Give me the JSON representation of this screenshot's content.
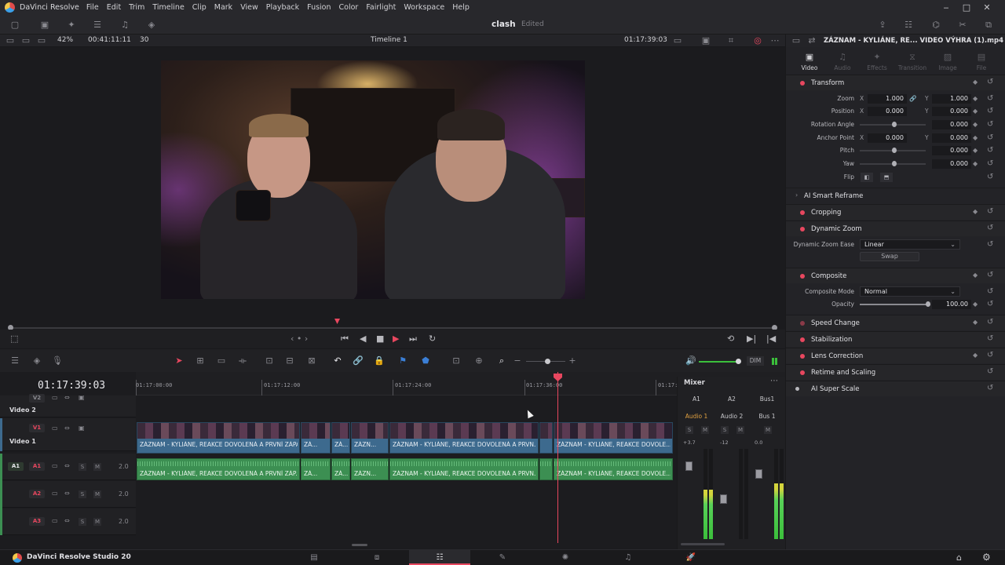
{
  "app": {
    "name": "DaVinci Resolve",
    "menus": [
      "File",
      "Edit",
      "Trim",
      "Timeline",
      "Clip",
      "Mark",
      "View",
      "Playback",
      "Fusion",
      "Color",
      "Fairlight",
      "Workspace",
      "Help"
    ],
    "window_controls": {
      "minimize": "‒",
      "maximize": "□",
      "close": "✕"
    }
  },
  "toolbar": {
    "project_name": "clash",
    "status": "Edited"
  },
  "viewer_bar": {
    "zoom": "42%",
    "duration_tc": "00:41:11:11",
    "fps": "30",
    "timeline_name": "Timeline 1",
    "current_tc": "01:17:39:03"
  },
  "inspector": {
    "clip_title": "ZÁZNAM - KYLIÁNE, RE... VIDEO VÝHRA (1).mp4",
    "tabs": [
      {
        "label": "Video",
        "icon": "video-icon",
        "active": true
      },
      {
        "label": "Audio",
        "icon": "audio-icon",
        "active": false
      },
      {
        "label": "Effects",
        "icon": "effects-icon",
        "active": false
      },
      {
        "label": "Transition",
        "icon": "transition-icon",
        "active": false
      },
      {
        "label": "Image",
        "icon": "image-icon",
        "active": false
      },
      {
        "label": "File",
        "icon": "file-icon",
        "active": false
      }
    ],
    "transform": {
      "title": "Transform",
      "zoom_label": "Zoom",
      "zoom_x": "1.000",
      "zoom_y": "1.000",
      "position_label": "Position",
      "position_x": "0.000",
      "position_y": "0.000",
      "rotation_label": "Rotation Angle",
      "rotation": "0.000",
      "anchor_label": "Anchor Point",
      "anchor_x": "0.000",
      "anchor_y": "0.000",
      "pitch_label": "Pitch",
      "pitch": "0.000",
      "yaw_label": "Yaw",
      "yaw": "0.000",
      "flip_label": "Flip",
      "x_axis": "X",
      "y_axis": "Y"
    },
    "ai_smart_reframe": "AI Smart Reframe",
    "cropping": "Cropping",
    "dynamic_zoom": {
      "title": "Dynamic Zoom",
      "ease_label": "Dynamic Zoom Ease",
      "ease_value": "Linear",
      "swap": "Swap"
    },
    "composite": {
      "title": "Composite",
      "mode_label": "Composite Mode",
      "mode_value": "Normal",
      "opacity_label": "Opacity",
      "opacity": "100.00"
    },
    "speed_change": "Speed Change",
    "stabilization": "Stabilization",
    "lens_correction": "Lens Correction",
    "retime_scaling": "Retime and Scaling",
    "ai_super_scale": "AI Super Scale"
  },
  "timeline": {
    "timecode": "01:17:39:03",
    "ruler_ticks": [
      "01:17:00:00",
      "01:17:12:00",
      "01:17:24:00",
      "01:17:36:00",
      "01:17:"
    ],
    "tracks": {
      "v2": {
        "badge": "V2",
        "name": "Video 2"
      },
      "v1": {
        "badge": "V1",
        "name": "Video 1"
      },
      "a1": {
        "badge": "A1",
        "patch": "A1",
        "level": "2.0"
      },
      "a2": {
        "badge": "A2",
        "level": "2.0"
      },
      "a3": {
        "badge": "A3",
        "level": "2.0"
      }
    },
    "solo": "S",
    "mute": "M",
    "video_clips": [
      "ZÁZNAM - KYLIÁNE, REAKCE DOVOLENÁ A PRVNÍ ZÁPASH ...",
      "ZÁ...",
      "ZÁ...",
      "ZÁZN...",
      "ZÁZNAM - KYLIÁNE, REAKCE DOVOLENÁ A PRVN...",
      "ZÁZNAM - KYLIÁNE, REAKCE DOVOLE..."
    ],
    "audio_clips": [
      "ZÁZNAM - KYLIÁNE, REAKCE DOVOLENÁ A PRVNÍ ZÁP...",
      "ZÁ...",
      "ZÁ...",
      "ZÁZN...",
      "ZÁZNAM - KYLIÁNE, REAKCE DOVOLENÁ A PRVN...",
      "ZÁZNAM - KYLIÁNE, REAKCE DOVOLE..."
    ]
  },
  "mixer": {
    "title": "Mixer",
    "channels": [
      "A1",
      "A2",
      "Bus1"
    ],
    "channel_names": [
      "Audio 1",
      "Audio 2",
      "Bus 1"
    ],
    "levels": [
      "+3.7",
      "-12",
      "0.0"
    ],
    "meter_levels": [
      0.55,
      0.0,
      0.62
    ],
    "solo": "S",
    "mute": "M",
    "dim": "DIM"
  },
  "status_bar": {
    "brand": "DaVinci Resolve Studio 20",
    "pages": [
      "media-icon",
      "cut-icon",
      "edit-icon",
      "fusion-icon",
      "color-icon",
      "fairlight-icon",
      "deliver-icon"
    ],
    "active_page": 2
  },
  "colors": {
    "accent": "#e8475f",
    "video_clip": "#3d6a8e",
    "audio_clip": "#3c8f52"
  }
}
